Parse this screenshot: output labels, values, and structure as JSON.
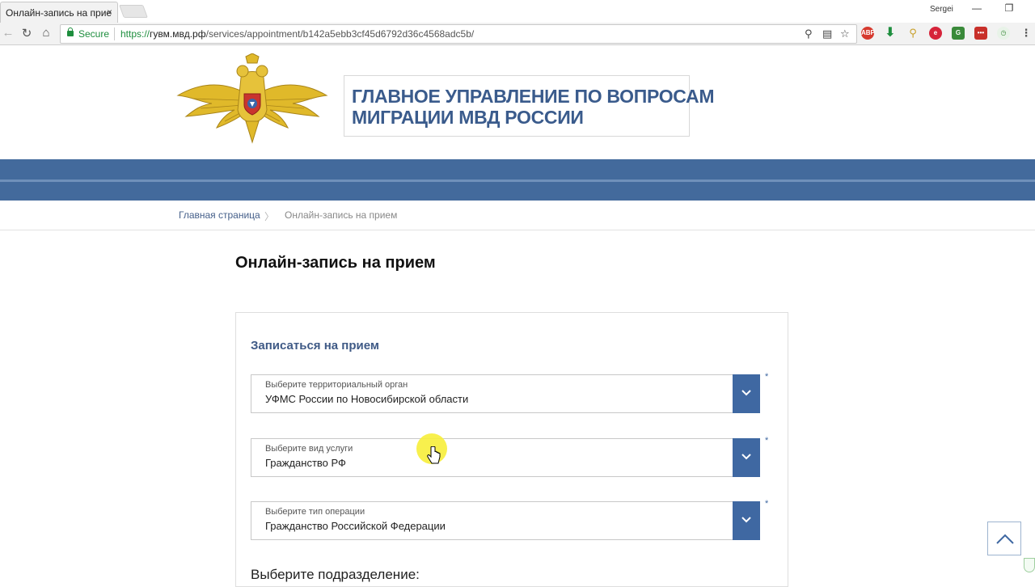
{
  "browser": {
    "tab_title": "Онлайн-запись на прие",
    "tab_close": "×",
    "user_name": "Sergei",
    "secure_label": "Secure",
    "url_scheme": "https://",
    "url_host": "гувм.мвд.рф",
    "url_path": "/services/appointment/b142a5ebb3cf45d6792d36c4568adc5b/"
  },
  "site": {
    "title_line1": "ГЛАВНОЕ УПРАВЛЕНИЕ ПО ВОПРОСАМ",
    "title_line2": "МИГРАЦИИ МВД РОССИИ"
  },
  "breadcrumb": {
    "home": "Главная страница",
    "separator": ">",
    "current": "Онлайн-запись на прием"
  },
  "page_title": "Онлайн-запись на прием",
  "form": {
    "title": "Записаться на прием",
    "selects": [
      {
        "label": "Выберите территориальный орган",
        "value": "УФМС России по Новосибирской области",
        "required": "*"
      },
      {
        "label": "Выберите вид услуги",
        "value": "Гражданство РФ",
        "required": "*"
      },
      {
        "label": "Выберите тип операции",
        "value": "Гражданство Российской Федерации",
        "required": "*"
      }
    ],
    "subdivision_label": "Выберите подразделение:"
  },
  "colors": {
    "brand_blue": "#436a9c",
    "select_arrow": "#3f68a2",
    "title_text": "#3a5b8c",
    "secure_green": "#1e8e3e"
  },
  "icons": [
    "emblem-logo",
    "reload-icon",
    "home-icon",
    "lock-icon",
    "zoom-icon",
    "translate-icon",
    "star-icon",
    "chevron-down-icon",
    "chevron-up-icon",
    "cursor-icon"
  ]
}
